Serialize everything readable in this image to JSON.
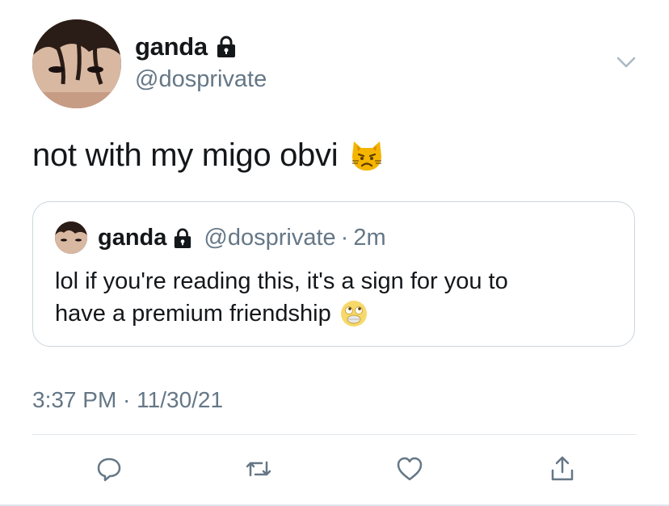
{
  "tweet": {
    "author_name": "ganda",
    "author_handle": "@dosprivate",
    "text": "not with my migo obvi",
    "timestamp": "3:37 PM · 11/30/21"
  },
  "quoted": {
    "author_name": "ganda",
    "author_handle": "@dosprivate",
    "separator": "·",
    "time": "2m",
    "text_line1": "lol if you're reading this, it's a sign for you to",
    "text_line2": "have a premium friendship"
  },
  "icons": {
    "lock": "lock-icon",
    "menu": "chevron-down-icon",
    "reply": "reply-icon",
    "retweet": "retweet-icon",
    "like": "heart-icon",
    "share": "share-icon",
    "emoji_tweet": "pouting-cat-emoji",
    "emoji_quote": "face-with-rolling-eyes-emoji"
  },
  "colors": {
    "text": "#14171a",
    "secondary": "#657786",
    "border": "#ccd6dd",
    "icon": "#657786"
  }
}
